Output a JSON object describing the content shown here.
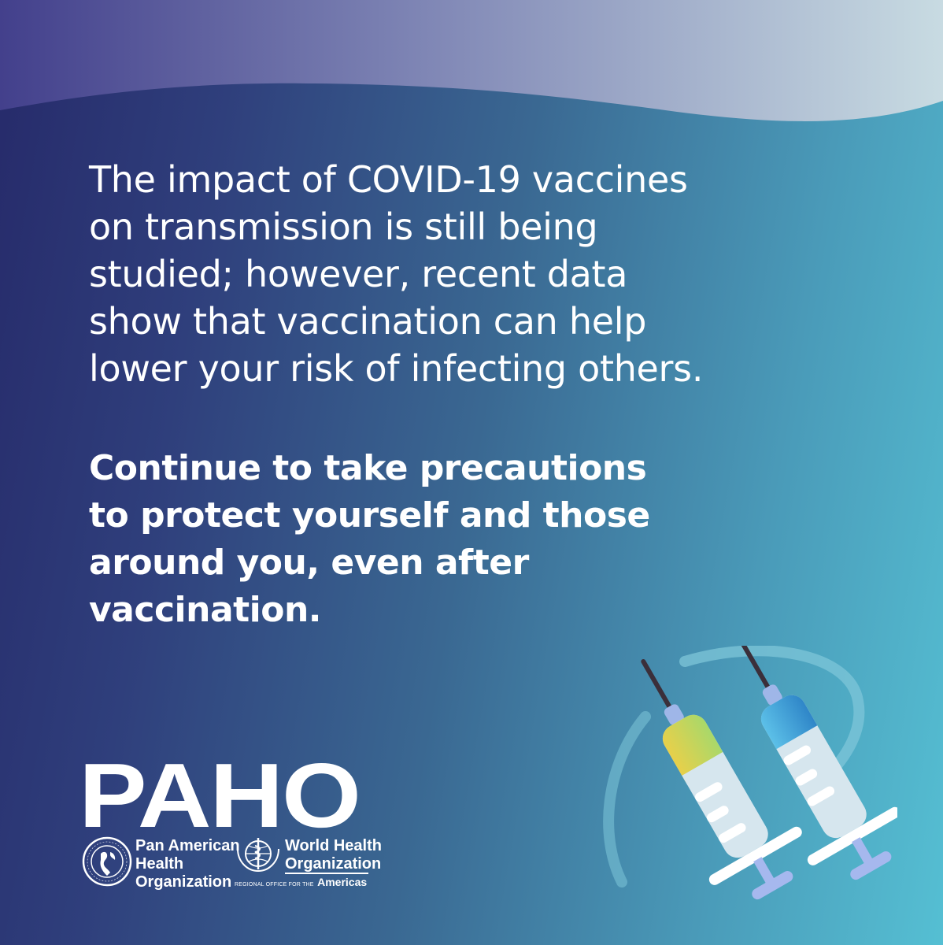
{
  "body_lines": [
    "The impact of COVID-19 vaccines",
    "on transmission is still being",
    "studied; however, recent data",
    "show that vaccination can help",
    "lower your risk of infecting others."
  ],
  "cta_lines": [
    "Continue to take precautions",
    "to protect yourself and those",
    "around you, even after",
    "vaccination."
  ],
  "logo": {
    "wordmark": "PAHO",
    "paho_org_lines": [
      "Pan American",
      "Health",
      "Organization"
    ],
    "who_org_lines": [
      "World Health",
      "Organization"
    ],
    "who_sub_small": "REGIONAL OFFICE FOR THE",
    "who_sub_region": "Americas"
  },
  "icons": {
    "paho_emblem": "paho-seal-icon",
    "who_emblem": "who-emblem-icon",
    "syringes": "vaccine-syringes-icon"
  },
  "colors": {
    "gradient_left": "#262a6a",
    "gradient_right": "#55bfd3",
    "text": "#ffffff",
    "syringe_yellow": "#e6d24c",
    "syringe_blue": "#3f9fd8",
    "ring": "#7ec6d8"
  }
}
